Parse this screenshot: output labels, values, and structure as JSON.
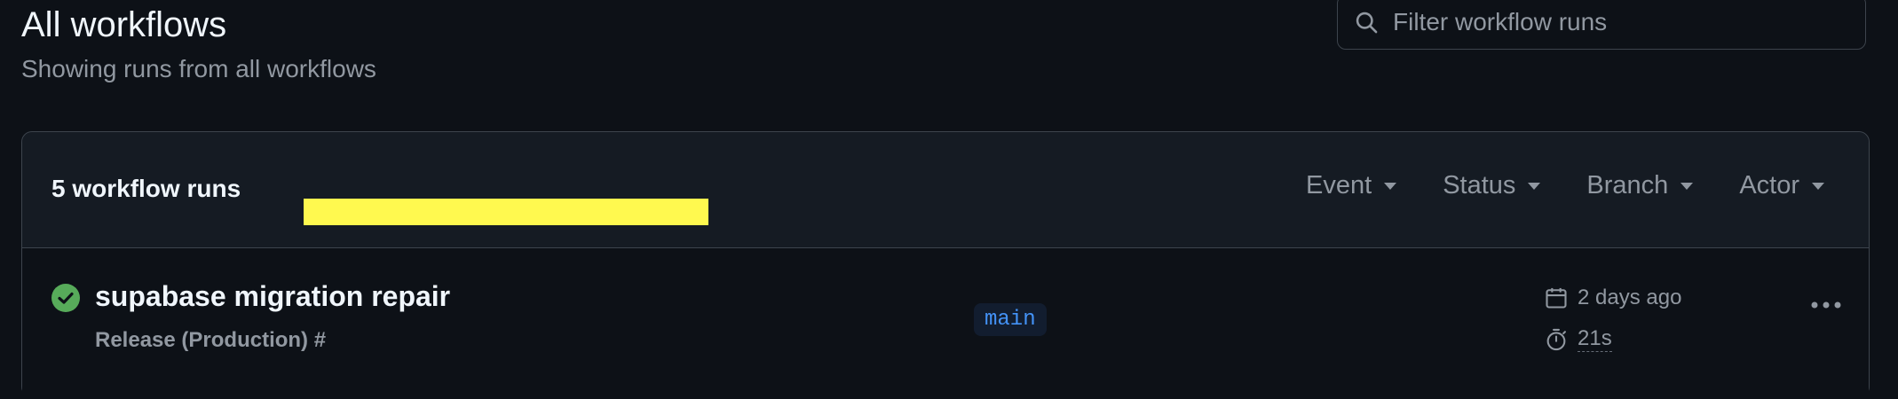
{
  "header": {
    "title": "All workflows",
    "subtitle": "Showing runs from all workflows"
  },
  "search": {
    "placeholder": "Filter workflow runs",
    "value": ""
  },
  "runs_box": {
    "count_label": "5 workflow runs",
    "filters": [
      {
        "label": "Event"
      },
      {
        "label": "Status"
      },
      {
        "label": "Branch"
      },
      {
        "label": "Actor"
      }
    ]
  },
  "runs": [
    {
      "title": "supabase migration repair",
      "workflow": "Release (Production) #",
      "branch": "main",
      "date": "2 days ago",
      "duration": "21s",
      "status": "success",
      "status_color": "#57ab5a"
    }
  ],
  "colors": {
    "background": "#0d1117",
    "box_background": "#151b23",
    "border": "#3d444d",
    "branch_text": "#4493f8",
    "success": "#57ab5a",
    "redaction": "#fff94f"
  }
}
